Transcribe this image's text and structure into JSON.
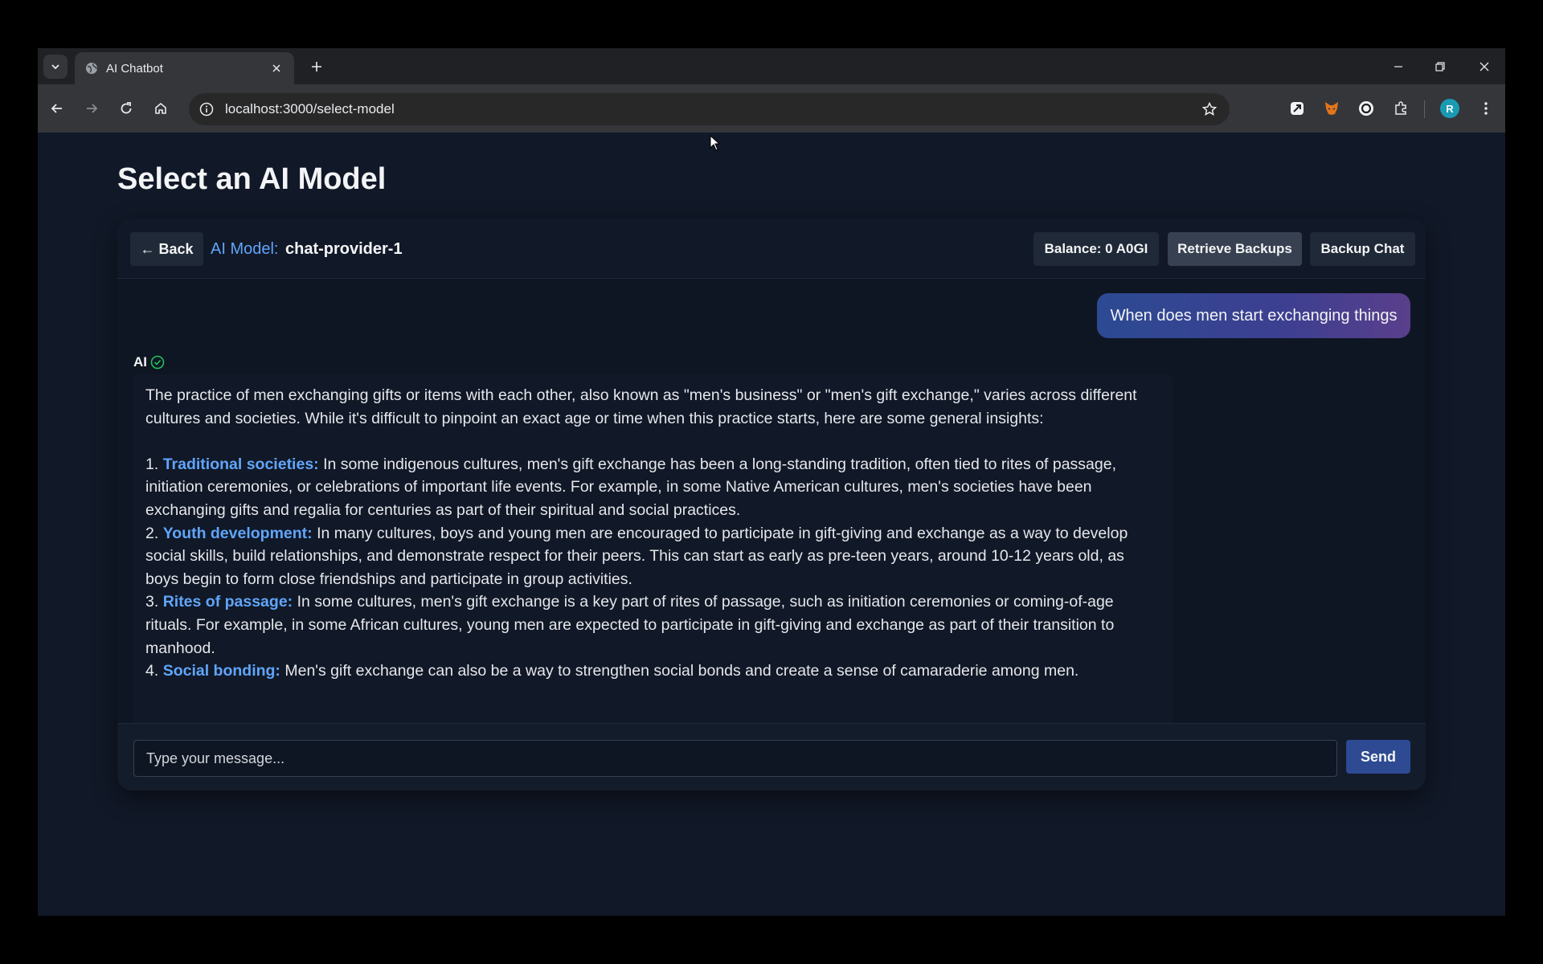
{
  "browser": {
    "tab_title": "AI Chatbot",
    "url": "localhost:3000/select-model",
    "profile_initial": "R"
  },
  "page": {
    "title": "Select an AI Model"
  },
  "chat": {
    "back_label": "← Back",
    "model_label": "AI Model:",
    "model_name": "chat-provider-1",
    "balance": "Balance: 0 A0GI",
    "retrieve_backups": "Retrieve Backups",
    "backup_chat": "Backup Chat",
    "user_message": "When does men start exchanging things",
    "ai_label": "AI",
    "ai_intro": "The practice of men exchanging gifts or items with each other, also known as \"men's business\" or \"men's gift exchange,\" varies across different cultures and societies. While it's difficult to pinpoint an exact age or time when this practice starts, here are some general insights:",
    "points": [
      {
        "num": "1.",
        "heading": "Traditional societies:",
        "text": "In some indigenous cultures, men's gift exchange has been a long-standing tradition, often tied to rites of passage, initiation ceremonies, or celebrations of important life events. For example, in some Native American cultures, men's societies have been exchanging gifts and regalia for centuries as part of their spiritual and social practices."
      },
      {
        "num": "2.",
        "heading": "Youth development:",
        "text": "In many cultures, boys and young men are encouraged to participate in gift-giving and exchange as a way to develop social skills, build relationships, and demonstrate respect for their peers. This can start as early as pre-teen years, around 10-12 years old, as boys begin to form close friendships and participate in group activities."
      },
      {
        "num": "3.",
        "heading": "Rites of passage:",
        "text": "In some cultures, men's gift exchange is a key part of rites of passage, such as initiation ceremonies or coming-of-age rituals. For example, in some African cultures, young men are expected to participate in gift-giving and exchange as part of their transition to manhood."
      },
      {
        "num": "4.",
        "heading": "Social bonding:",
        "text": "Men's gift exchange can also be a way to strengthen social bonds and create a sense of camaraderie among men."
      }
    ],
    "input_placeholder": "Type your message...",
    "send_label": "Send"
  },
  "colors": {
    "accent": "#60a5fa",
    "page_bg": "#111827",
    "verified": "#22c55e"
  }
}
